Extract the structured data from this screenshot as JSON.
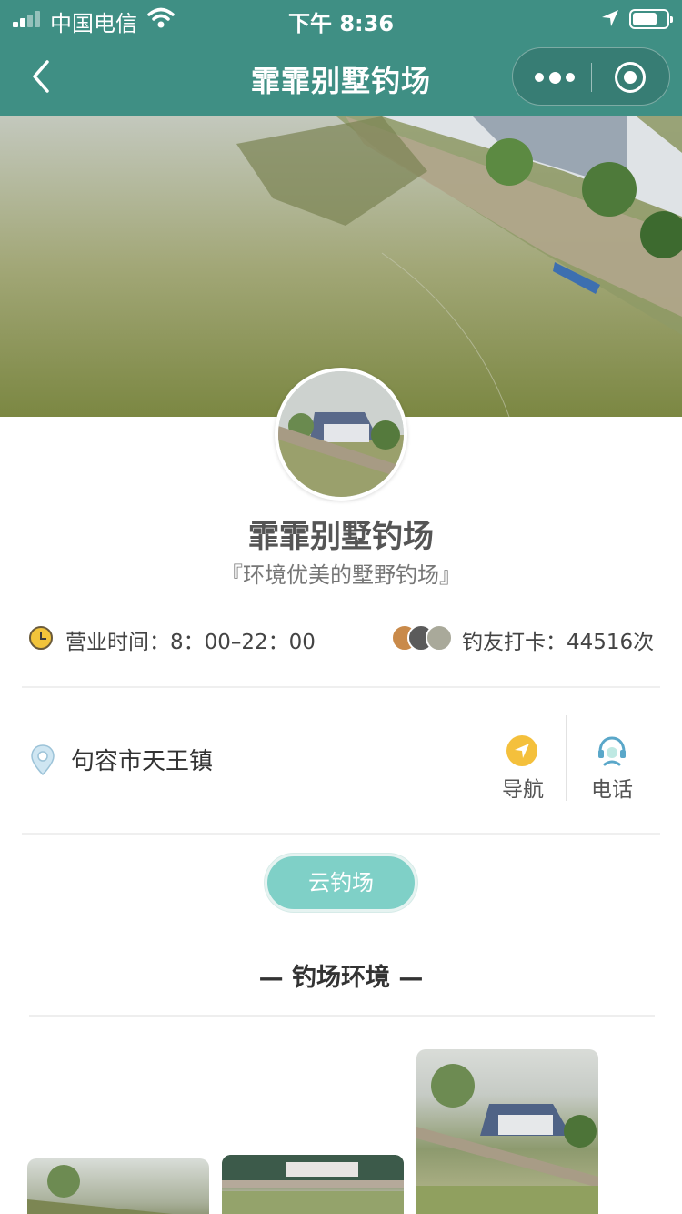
{
  "status_bar": {
    "carrier": "中国电信",
    "time": "下午 8:36"
  },
  "nav": {
    "title": "霏霏别墅钓场",
    "back_icon": "chevron-left-icon",
    "more_icon": "more-dots-icon",
    "close_icon": "target-circle-icon"
  },
  "venue": {
    "name": "霏霏别墅钓场",
    "slogan": "『环境优美的墅野钓场』",
    "hours": "营业时间：8：00–22：00",
    "checkins": "钓友打卡：44516次",
    "address": "句容市天王镇",
    "navigate_label": "导航",
    "call_label": "电话",
    "cloud_button": "云钓场"
  },
  "section": {
    "title": "— 钓场环境 —"
  },
  "colors": {
    "header_bg": "#3f8f84",
    "accent_teal": "#7fd0c7",
    "nav_icon_yellow": "#f4c03c"
  }
}
